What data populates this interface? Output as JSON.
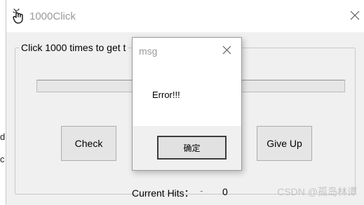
{
  "left_edge": {
    "text_1": "d",
    "text_2": "c"
  },
  "window": {
    "title": "1000Click",
    "icon": "pointing-hand-icon",
    "close_icon": "close-icon",
    "group_label": "Click 1000 times to get t",
    "progress_value": 0,
    "buttons": {
      "check": "Check",
      "give_up": "Give Up"
    },
    "hits_label": "Current Hits：",
    "hits_dash": "-",
    "hits_value": "0"
  },
  "dialog": {
    "title": "msg",
    "message": "Error!!!",
    "ok_label": "确定"
  },
  "watermark": "CSDN @孤岛林谭"
}
